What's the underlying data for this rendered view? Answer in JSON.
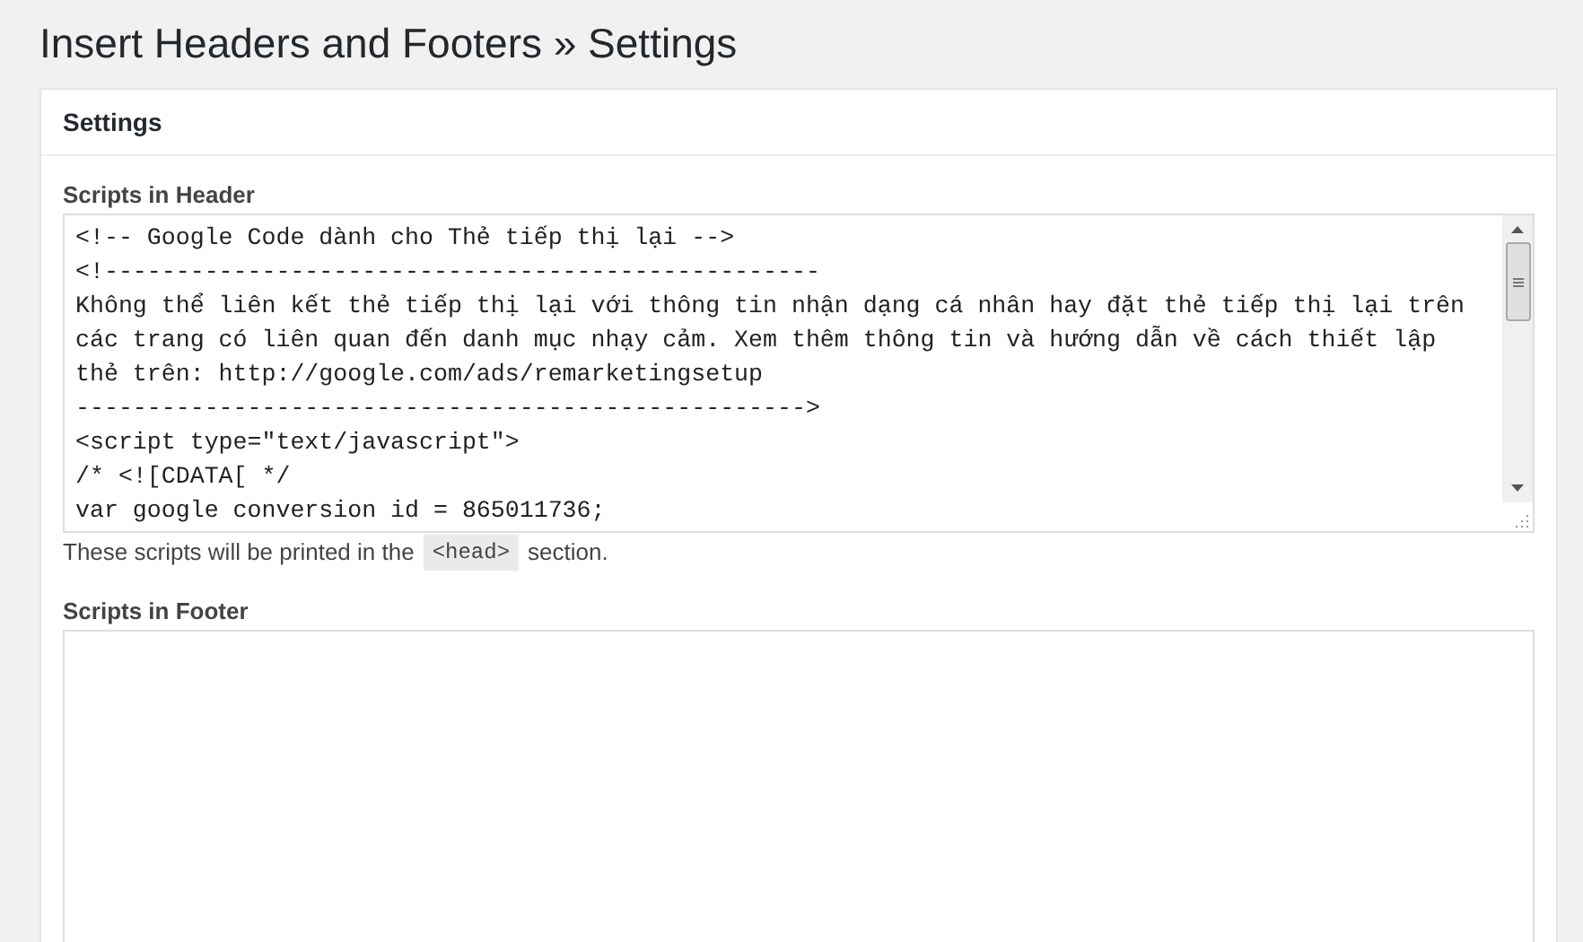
{
  "page_title": "Insert Headers and Footers » Settings",
  "panel": {
    "title": "Settings"
  },
  "header_scripts": {
    "label": "Scripts in Header",
    "value_lines": [
      "<!-- Google Code dành cho Thẻ tiếp thị lại -->",
      "<!--------------------------------------------------",
      "Không thể liên kết thẻ tiếp thị lại với thông tin nhận dạng cá nhân hay đặt thẻ tiếp thị lại trên",
      "các trang có liên quan đến danh mục nhạy cảm. Xem thêm thông tin và hướng dẫn về cách thiết lập",
      "thẻ trên: http://google.com/ads/remarketingsetup",
      "--------------------------------------------------->",
      "<script type=\"text/javascript\">",
      "/* <![CDATA[ */",
      "var google conversion id = 865011736;"
    ],
    "help_before": "These scripts will be printed in the",
    "help_code": "<head>",
    "help_after": "section."
  },
  "footer_scripts": {
    "label": "Scripts in Footer"
  }
}
